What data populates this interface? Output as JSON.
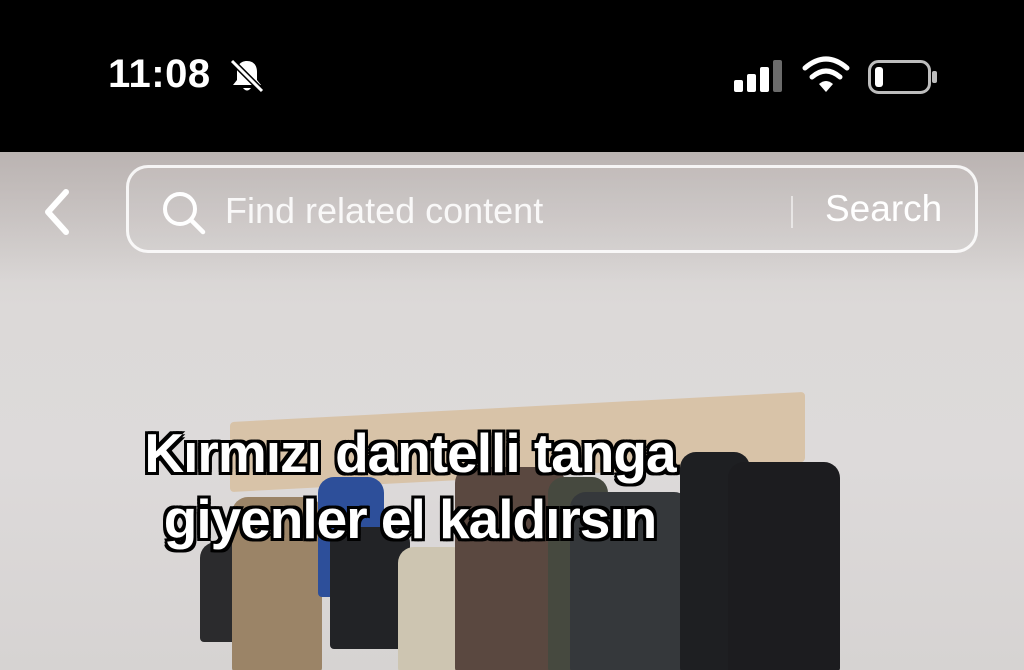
{
  "status_bar": {
    "time": "11:08",
    "icons": [
      "bell-slash-icon",
      "cellular-signal-icon",
      "wifi-icon",
      "battery-icon"
    ]
  },
  "top_bar": {
    "back_icon": "chevron-left-icon",
    "search": {
      "placeholder": "Find related content",
      "button_label": "Search",
      "icon": "search-icon"
    }
  },
  "video": {
    "caption_lines": [
      "Kırmızı dantelli tanga",
      "giyenler el kaldırsın"
    ]
  },
  "colors": {
    "status_bar_bg": "#000000",
    "text": "#ffffff",
    "wall": "#dcd9d8"
  }
}
